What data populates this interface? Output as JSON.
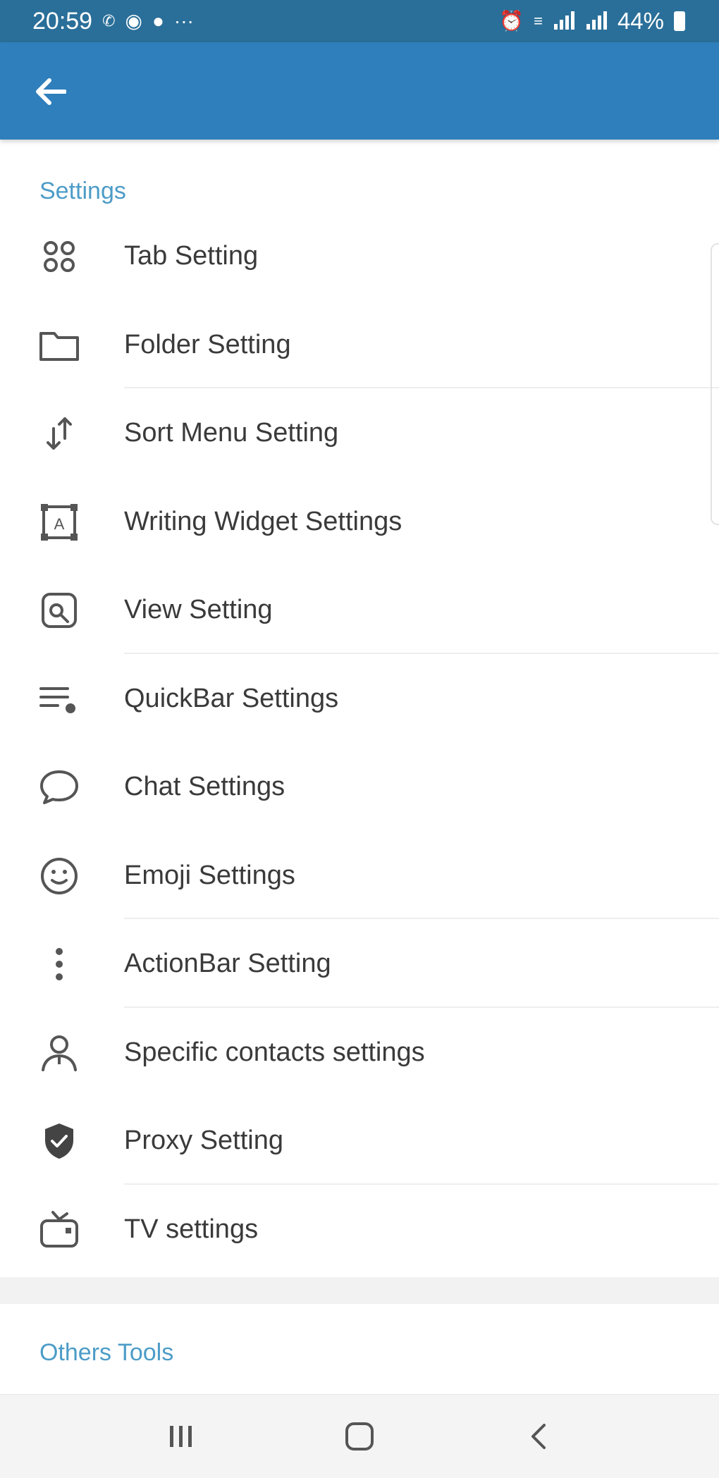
{
  "status_bar": {
    "time": "20:59",
    "battery": "44%"
  },
  "app_bar": {
    "back_icon": "arrow-left-icon"
  },
  "sections": {
    "settings": {
      "header": "Settings",
      "items": [
        {
          "label": "Tab Setting",
          "icon": "tab-grid-icon"
        },
        {
          "label": "Folder Setting",
          "icon": "folder-icon"
        },
        {
          "label": "Sort Menu Setting",
          "icon": "sort-arrows-icon"
        },
        {
          "label": "Writing Widget Settings",
          "icon": "writing-widget-icon"
        },
        {
          "label": "View Setting",
          "icon": "view-icon"
        },
        {
          "label": "QuickBar Settings",
          "icon": "quickbar-icon"
        },
        {
          "label": "Chat Settings",
          "icon": "chat-bubble-icon"
        },
        {
          "label": "Emoji Settings",
          "icon": "emoji-icon"
        },
        {
          "label": "ActionBar Setting",
          "icon": "more-vertical-icon"
        },
        {
          "label": "Specific contacts settings",
          "icon": "contact-icon"
        },
        {
          "label": "Proxy Setting",
          "icon": "shield-icon"
        },
        {
          "label": "TV settings",
          "icon": "tv-icon"
        }
      ]
    },
    "others_tools": {
      "header": "Others Tools"
    }
  },
  "colors": {
    "status_bar": "#2a6f99",
    "app_bar": "#2e7fbc",
    "section_header": "#4d9cc7",
    "label_text": "#3a3a3a",
    "icon": "#555555"
  },
  "nav_bar": {
    "recent_icon": "recent-apps-icon",
    "home_icon": "home-icon",
    "back_icon": "nav-back-icon"
  }
}
